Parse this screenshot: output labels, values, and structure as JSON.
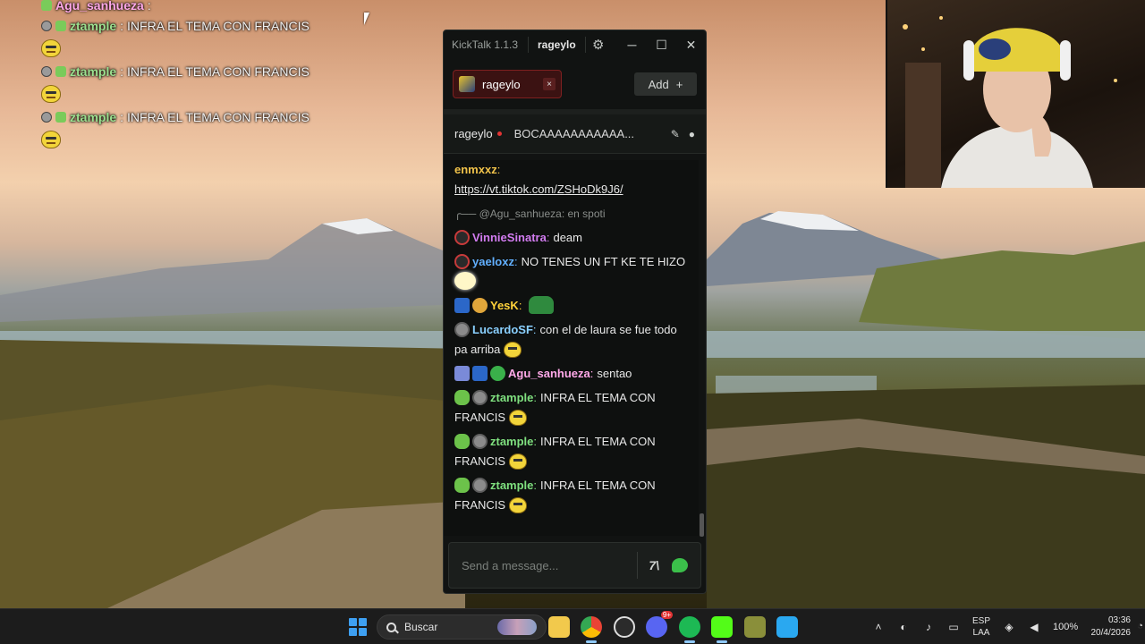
{
  "overlay": {
    "top_line": {
      "user": "Agu_sanhueza",
      "sep": ":"
    },
    "lines": [
      {
        "user": "ztample",
        "sep": ":",
        "text": "INFRA EL TEMA CON FRANCIS"
      },
      {
        "user": "ztample",
        "sep": ":",
        "text": "INFRA EL TEMA CON FRANCIS"
      },
      {
        "user": "ztample",
        "sep": ":",
        "text": "INFRA EL TEMA CON FRANCIS"
      }
    ]
  },
  "window": {
    "app_name": "KickTalk 1.1.3",
    "current_user": "rageylo",
    "settings_icon": "gear-icon",
    "minimize": "─",
    "maximize": "☐",
    "close": "✕"
  },
  "tabs": [
    {
      "label": "rageylo",
      "close": "×"
    }
  ],
  "add_button": {
    "label": "Add",
    "icon": "+"
  },
  "stream": {
    "channel": "rageylo",
    "title": "BOCAAAAAAAAAAA..."
  },
  "messages": [
    {
      "user": "enmxxz",
      "color": "#f0c24a",
      "sep": ":",
      "link": "https://vt.tiktok.com/ZSHoDk9J6/"
    },
    {
      "reply_to": "@Agu_sanhueza: en spoti"
    },
    {
      "user": "VinnieSinatra",
      "color": "#d27cf0",
      "sep": ":",
      "text": "deam"
    },
    {
      "user": "yaeloxz",
      "color": "#62b0ff",
      "sep": ":",
      "text": "NO TENES UN FT KE TE HIZO"
    },
    {
      "user": "YesK",
      "color": "#ffd23a",
      "sep": ":"
    },
    {
      "user": "LucardoSF",
      "color": "#8ad0ff",
      "sep": ":",
      "text": "con el de laura se fue todo pa arriba"
    },
    {
      "user": "Agu_sanhueza",
      "color": "#ffa8e8",
      "sep": ":",
      "text": "sentao"
    },
    {
      "user": "ztample",
      "color": "#7fe07f",
      "sep": ":",
      "text": "INFRA EL TEMA CON FRANCIS"
    },
    {
      "user": "ztample",
      "color": "#7fe07f",
      "sep": ":",
      "text": "INFRA EL TEMA CON FRANCIS"
    },
    {
      "user": "ztample",
      "color": "#7fe07f",
      "sep": ":",
      "text": "INFRA EL TEMA CON FRANCIS"
    }
  ],
  "chat_input": {
    "placeholder": "Send a message...",
    "seventv_label": "7\\"
  },
  "taskbar": {
    "search_label": "Buscar",
    "lang_top": "ESP",
    "lang_bottom": "LAA",
    "battery": "100%",
    "time": "03:36",
    "date": "20/4/2026",
    "discord_badge": "9+"
  }
}
